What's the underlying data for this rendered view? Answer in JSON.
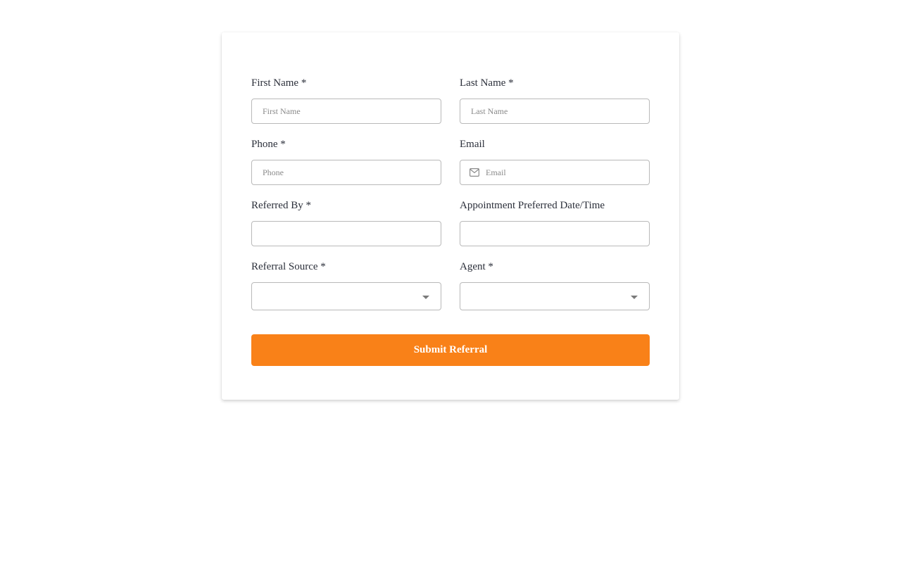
{
  "form": {
    "first_name": {
      "label": "First Name *",
      "placeholder": "First Name",
      "value": ""
    },
    "last_name": {
      "label": "Last Name *",
      "placeholder": "Last Name",
      "value": ""
    },
    "phone": {
      "label": "Phone *",
      "placeholder": "Phone",
      "value": ""
    },
    "email": {
      "label": "Email",
      "placeholder": "Email",
      "value": "",
      "icon": "mail-icon"
    },
    "referred_by": {
      "label": "Referred By *",
      "placeholder": "",
      "value": ""
    },
    "appointment": {
      "label": "Appointment Preferred Date/Time",
      "placeholder": "",
      "value": ""
    },
    "referral_source": {
      "label": "Referral Source *",
      "selected": "",
      "icon": "caret-down-icon"
    },
    "agent": {
      "label": "Agent *",
      "selected": "",
      "icon": "caret-down-icon"
    },
    "submit_label": "Submit Referral"
  },
  "colors": {
    "accent": "#f98118",
    "label_text": "#2b2f3a",
    "border": "#b9b9b9"
  }
}
